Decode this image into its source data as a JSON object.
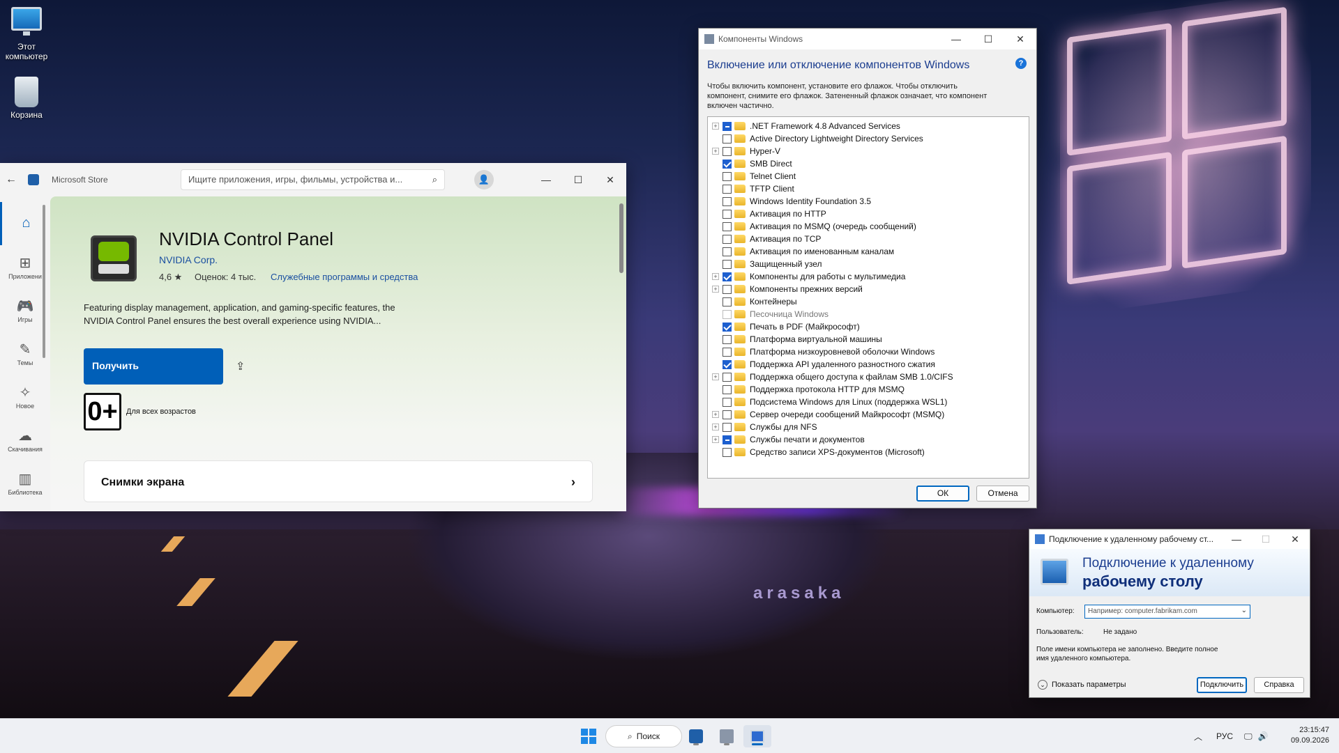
{
  "desktop": {
    "icons": [
      {
        "label_line1": "Этот",
        "label_line2": "компьютер",
        "icon": "computer-icon"
      },
      {
        "label_line1": "Корзина",
        "label_line2": "",
        "icon": "recycle-bin-icon"
      }
    ],
    "wallpaper_brand": "arasaka"
  },
  "store": {
    "window_title": "Microsoft Store",
    "search_placeholder": "Ищите приложения, игры, фильмы, устройства и...",
    "nav": [
      {
        "label": "",
        "icon": "home-icon"
      },
      {
        "label": "Приложени",
        "icon": "apps-icon"
      },
      {
        "label": "Игры",
        "icon": "gamepad-icon"
      },
      {
        "label": "Темы",
        "icon": "brush-icon"
      },
      {
        "label": "Новое",
        "icon": "sparkle-icon"
      },
      {
        "label": "Скачивания",
        "icon": "download-icon"
      },
      {
        "label": "Библиотека",
        "icon": "library-icon"
      }
    ],
    "app": {
      "name": "NVIDIA Control Panel",
      "publisher": "NVIDIA Corp.",
      "rating": "4,6 ★",
      "reviews": "Оценок: 4 тыс.",
      "category": "Служебные программы и средства",
      "description_line1": "Featuring display management, application, and gaming-specific features, the",
      "description_line2": "NVIDIA Control Panel ensures the best overall experience using NVIDIA...",
      "get_label": "Получить",
      "age_rating": "0+",
      "age_text": "Для всех возрастов",
      "screenshots_label": "Снимки экрана"
    }
  },
  "components": {
    "window_title": "Компоненты Windows",
    "heading": "Включение или отключение компонентов Windows",
    "description_line1": "Чтобы включить компонент, установите его флажок. Чтобы отключить",
    "description_line2": "компонент, снимите его флажок. Затененный флажок означает, что компонент",
    "description_line3": "включен частично.",
    "items": [
      {
        "label": ".NET Framework 4.8 Advanced Services",
        "state": "partial",
        "expandable": true
      },
      {
        "label": "Active Directory Lightweight Directory Services",
        "state": "unchecked",
        "expandable": false
      },
      {
        "label": "Hyper-V",
        "state": "unchecked",
        "expandable": true
      },
      {
        "label": "SMB Direct",
        "state": "checked",
        "expandable": false
      },
      {
        "label": "Telnet Client",
        "state": "unchecked",
        "expandable": false
      },
      {
        "label": "TFTP Client",
        "state": "unchecked",
        "expandable": false
      },
      {
        "label": "Windows Identity Foundation 3.5",
        "state": "unchecked",
        "expandable": false
      },
      {
        "label": "Активация по HTTP",
        "state": "unchecked",
        "expandable": false
      },
      {
        "label": "Активация по MSMQ (очередь сообщений)",
        "state": "unchecked",
        "expandable": false
      },
      {
        "label": "Активация по TCP",
        "state": "unchecked",
        "expandable": false
      },
      {
        "label": "Активация по именованным каналам",
        "state": "unchecked",
        "expandable": false
      },
      {
        "label": "Защищенный узел",
        "state": "unchecked",
        "expandable": false
      },
      {
        "label": "Компоненты для работы с мультимедиа",
        "state": "checked",
        "expandable": true
      },
      {
        "label": "Компоненты прежних версий",
        "state": "unchecked",
        "expandable": true
      },
      {
        "label": "Контейнеры",
        "state": "unchecked",
        "expandable": false
      },
      {
        "label": "Песочница Windows",
        "state": "disabled",
        "expandable": false
      },
      {
        "label": "Печать в PDF (Майкрософт)",
        "state": "checked",
        "expandable": false
      },
      {
        "label": "Платформа виртуальной машины",
        "state": "unchecked",
        "expandable": false
      },
      {
        "label": "Платформа низкоуровневой оболочки Windows",
        "state": "unchecked",
        "expandable": false
      },
      {
        "label": "Поддержка API удаленного разностного сжатия",
        "state": "checked",
        "expandable": false
      },
      {
        "label": "Поддержка общего доступа к файлам SMB 1.0/CIFS",
        "state": "unchecked",
        "expandable": true
      },
      {
        "label": "Поддержка протокола HTTP для MSMQ",
        "state": "unchecked",
        "expandable": false
      },
      {
        "label": "Подсистема Windows для Linux (поддержка WSL1)",
        "state": "unchecked",
        "expandable": false
      },
      {
        "label": "Сервер очереди сообщений Майкрософт (MSMQ)",
        "state": "unchecked",
        "expandable": true
      },
      {
        "label": "Службы для NFS",
        "state": "unchecked",
        "expandable": true
      },
      {
        "label": "Службы печати и документов",
        "state": "partial",
        "expandable": true
      },
      {
        "label": "Средство записи XPS-документов (Microsoft)",
        "state": "unchecked",
        "expandable": false
      }
    ],
    "ok_label": "ОК",
    "cancel_label": "Отмена"
  },
  "rdp": {
    "window_title": "Подключение к удаленному рабочему ст...",
    "banner_line1": "Подключение к удаленному",
    "banner_line2": "рабочему столу",
    "computer_label": "Компьютер:",
    "computer_placeholder": "Например: computer.fabrikam.com",
    "user_label": "Пользователь:",
    "user_value": "Не задано",
    "notice_line1": "Поле имени компьютера не заполнено. Введите полное",
    "notice_line2": "имя удаленного компьютера.",
    "show_options": "Показать параметры",
    "connect_label": "Подключить",
    "help_label": "Справка"
  },
  "taskbar": {
    "search_label": "Поиск",
    "language": "РУС",
    "time": "23:15:47",
    "date": "09.09.2026"
  },
  "colors": {
    "store_accent": "#005fb8",
    "checkbox_checked": "#1d5fcf",
    "heading_blue": "#1b3d8f"
  }
}
